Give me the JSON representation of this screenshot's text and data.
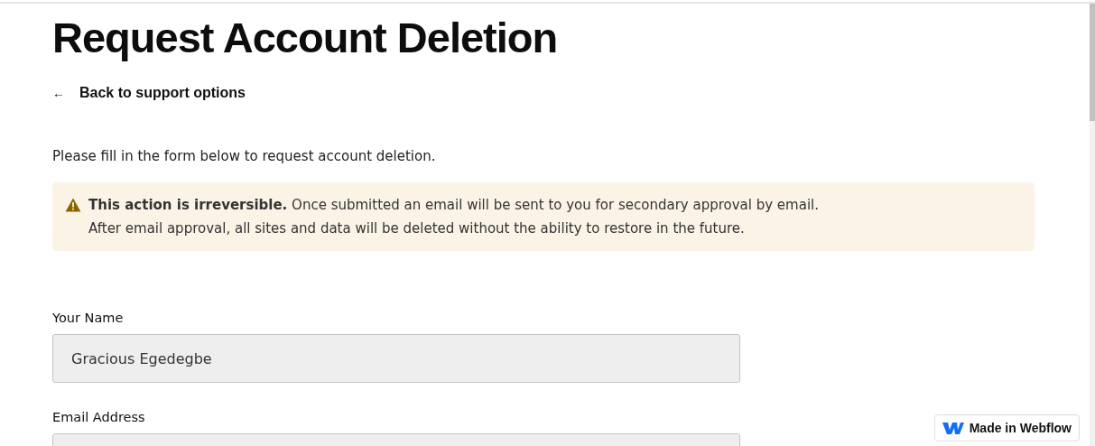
{
  "title": "Request Account Deletion",
  "back_link": {
    "icon": "←",
    "label": "Back to support options"
  },
  "intro": "Please fill in the form below to request account deletion.",
  "warning": {
    "lines": [
      "**This action is irreversible.** Once submitted an email will be sent to you for secondary approval by email.",
      "After email approval, all sites and data will be deleted without the ability to restore in the future."
    ]
  },
  "fields": [
    {
      "label": "Your Name",
      "value": "Gracious Egedegbe"
    },
    {
      "label": "Email Address"
    }
  ],
  "badge": {
    "label": "Made in Webflow"
  }
}
